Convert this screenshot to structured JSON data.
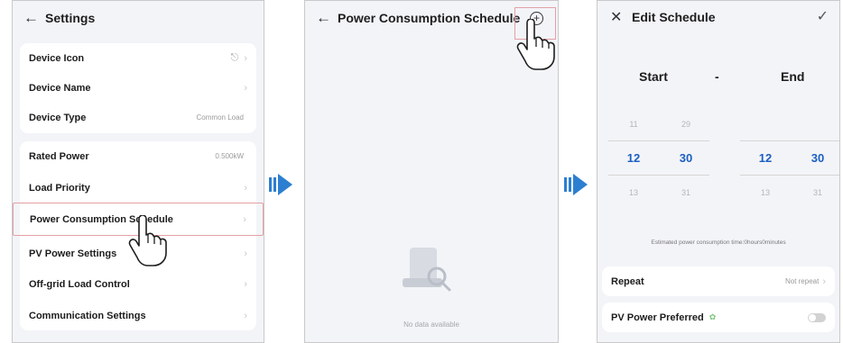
{
  "panel1": {
    "back_icon": "arrow-left-icon",
    "title": "Settings",
    "group1": [
      {
        "label": "Device Icon",
        "value": "",
        "icon": "plug-icon"
      },
      {
        "label": "Device Name",
        "value": ""
      },
      {
        "label": "Device Type",
        "value": "Common Load"
      }
    ],
    "group2": [
      {
        "label": "Rated Power",
        "value": "0.500kW"
      },
      {
        "label": "Load Priority",
        "value": ""
      },
      {
        "label": "Power Consumption Schedule",
        "value": "",
        "highlighted": true
      },
      {
        "label": "PV Power Settings",
        "value": ""
      },
      {
        "label": "Off-grid Load Control",
        "value": ""
      },
      {
        "label": "Communication Settings",
        "value": ""
      }
    ]
  },
  "panel2": {
    "back_icon": "arrow-left-icon",
    "title": "Power Consumption Schedule",
    "add_icon": "add-circle-icon",
    "empty_text": "No data available"
  },
  "panel3": {
    "close_icon": "close-icon",
    "title": "Edit Schedule",
    "confirm_icon": "check-icon",
    "start_label": "Start",
    "separator": "-",
    "end_label": "End",
    "start": {
      "hour_prev": "11",
      "minute_prev": "29",
      "hour": "12",
      "minute": "30",
      "hour_next": "13",
      "minute_next": "31"
    },
    "end": {
      "hour_prev": "",
      "minute_prev": "",
      "hour": "12",
      "minute": "30",
      "hour_next": "13",
      "minute_next": "31"
    },
    "hint": "Estimated power consumption time:0hours0minutes",
    "repeat_label": "Repeat",
    "repeat_value": "Not repeat",
    "pv_label": "PV Power Preferred",
    "pv_enabled": false
  },
  "colors": {
    "accent": "#1a5fc0",
    "highlight": "#e3a0a6",
    "flow_arrow": "#2c7fd0"
  }
}
